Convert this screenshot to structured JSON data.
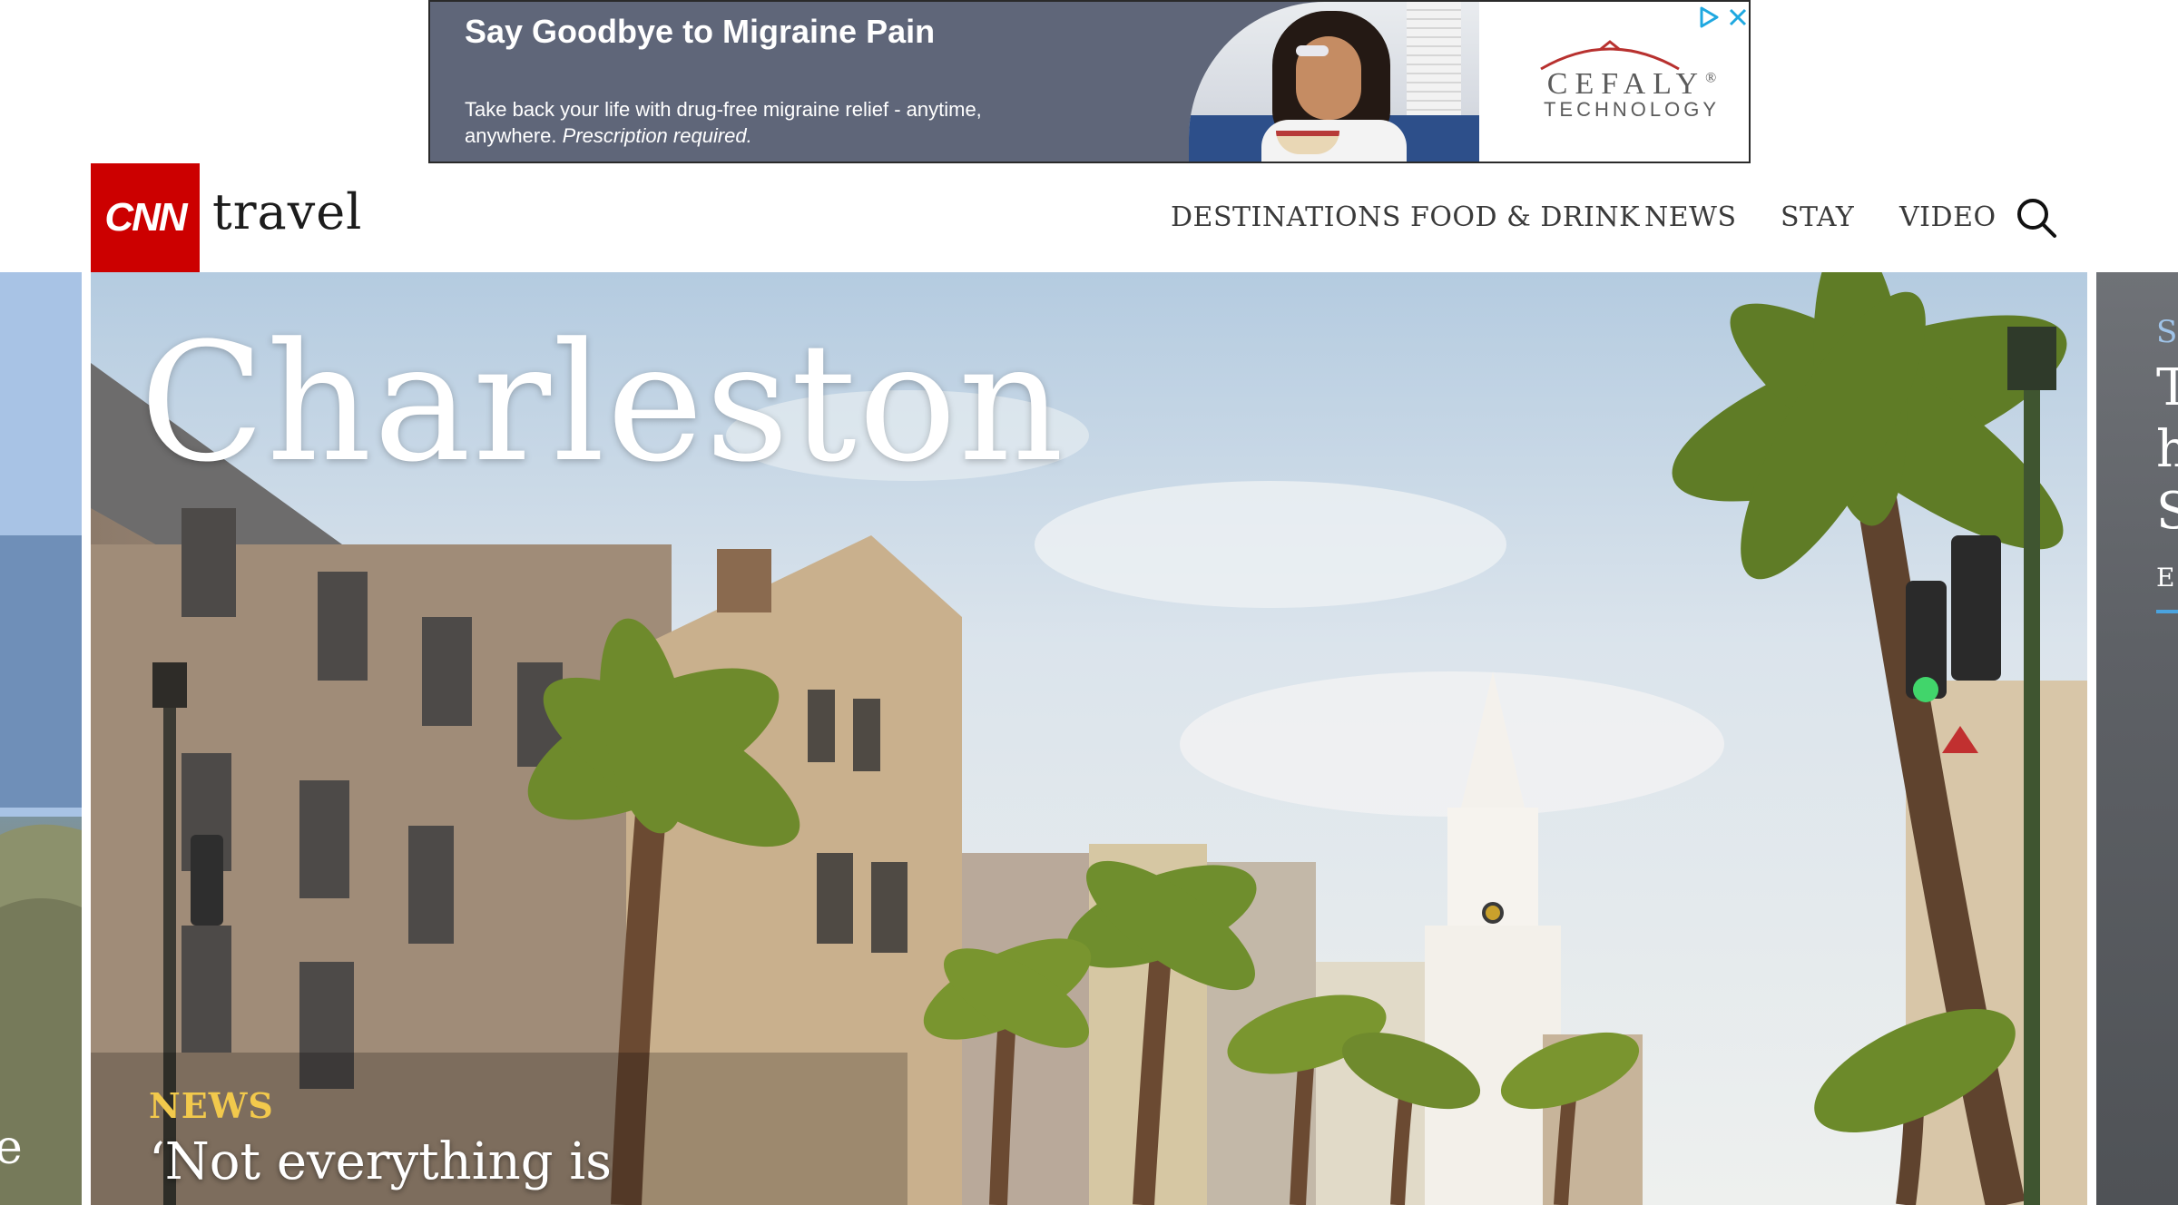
{
  "ad": {
    "headline": "Say Goodbye to Migraine Pain",
    "body": "Take back your life with drug-free migraine relief - anytime, anywhere.",
    "body_note": "Prescription required.",
    "brand": "CEFALY",
    "brand_mark": "®",
    "brand_sub": "TECHNOLOGY",
    "icons": [
      "adchoices-icon",
      "close-icon"
    ]
  },
  "header": {
    "logo": "CNN",
    "section": "travel",
    "nav": [
      "DESTINATIONS",
      "FOOD & DRINK",
      "NEWS",
      "STAY",
      "VIDEO"
    ],
    "search_icon": "search-icon"
  },
  "hero": {
    "title": "Charleston",
    "kicker": "NEWS",
    "headline": "‘Not everything is"
  },
  "colors": {
    "brand_red": "#cc0000",
    "ad_bg": "#5f6679",
    "kicker": "#f2c94c",
    "nav_text": "#3a3a3a"
  }
}
